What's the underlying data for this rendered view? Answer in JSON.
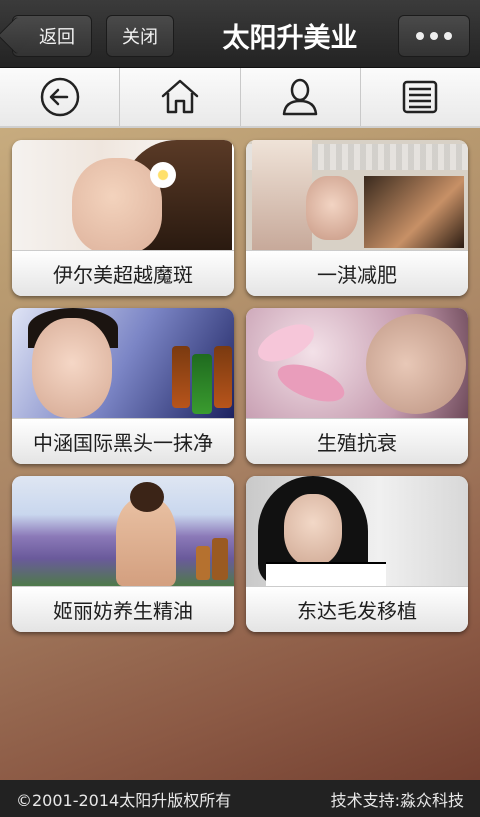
{
  "header": {
    "back_label": "返回",
    "close_label": "关闭",
    "title": "太阳升美业",
    "more_icon": "more-dots-icon"
  },
  "icon_nav": [
    {
      "icon": "back-arrow-icon"
    },
    {
      "icon": "home-icon"
    },
    {
      "icon": "user-icon"
    },
    {
      "icon": "list-icon"
    }
  ],
  "cards": [
    {
      "label": "伊尔美超越魔斑"
    },
    {
      "label": "一淇减肥"
    },
    {
      "label": "中涵国际黑头一抹净"
    },
    {
      "label": "生殖抗衰"
    },
    {
      "label": "姬丽妨养生精油"
    },
    {
      "label": "东达毛发移植"
    }
  ],
  "footer": {
    "copyright": "©2001-2014太阳升版权所有",
    "support": "技术支持:淼众科技"
  },
  "colors": {
    "topbar": "#2e2e2e",
    "footer": "#222222",
    "background_top": "#d3b98a",
    "background_bottom": "#6e3a2c"
  }
}
